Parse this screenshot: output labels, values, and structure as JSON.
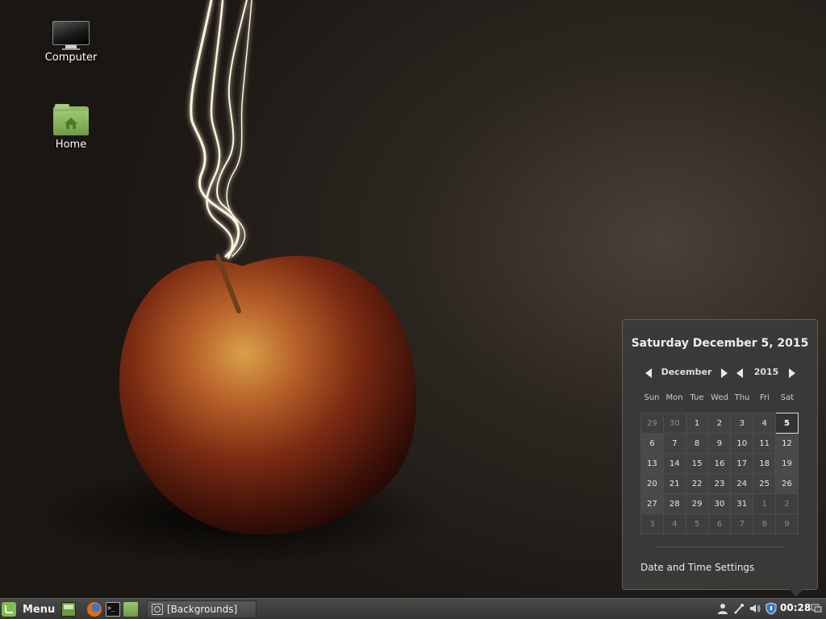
{
  "desktop": {
    "icons": [
      {
        "label": "Computer",
        "icon": "computer-icon"
      },
      {
        "label": "Home",
        "icon": "home-folder-icon"
      }
    ]
  },
  "calendar": {
    "date_title": "Saturday December  5, 2015",
    "month": "December",
    "year": "2015",
    "weekdays": [
      "Sun",
      "Mon",
      "Tue",
      "Wed",
      "Thu",
      "Fri",
      "Sat"
    ],
    "weeks": [
      [
        "29",
        "30",
        "1",
        "2",
        "3",
        "4",
        "5"
      ],
      [
        "6",
        "7",
        "8",
        "9",
        "10",
        "11",
        "12"
      ],
      [
        "13",
        "14",
        "15",
        "16",
        "17",
        "18",
        "19"
      ],
      [
        "20",
        "21",
        "22",
        "23",
        "24",
        "25",
        "26"
      ],
      [
        "27",
        "28",
        "29",
        "30",
        "31",
        "1",
        "2"
      ],
      [
        "3",
        "4",
        "5",
        "6",
        "7",
        "8",
        "9"
      ]
    ],
    "today": "5",
    "settings_label": "Date and Time Settings"
  },
  "panel": {
    "menu_label": "Menu",
    "launchers": [
      "show-desktop-icon",
      "firefox-icon",
      "terminal-icon",
      "files-icon"
    ],
    "task": {
      "label": "[Backgrounds]",
      "icon": "backgrounds-app-icon"
    },
    "tray": [
      "user-icon",
      "network-icon",
      "volume-icon",
      "shield-icon",
      "windows-icon"
    ],
    "clock": "00:28"
  },
  "colors": {
    "mint_green": "#7fbf4d",
    "popup_bg": "#3a3a3a",
    "panel_bg": "#3d3d3d"
  }
}
